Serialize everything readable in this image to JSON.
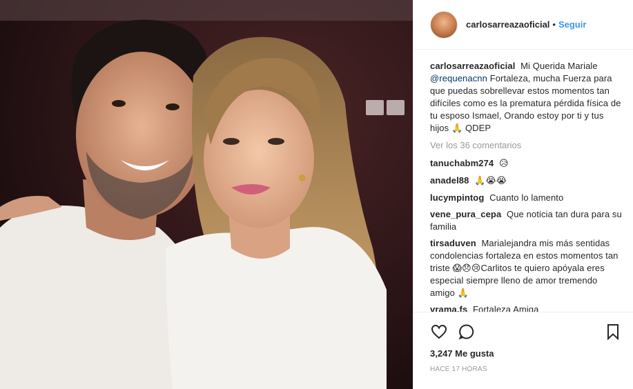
{
  "post": {
    "author": "carlosarreazaoficial",
    "dot": "•",
    "follow_label": "Seguir",
    "caption": {
      "user": "carlosarreazaoficial",
      "text_before_mention": "Mi Querida Mariale",
      "mention": "@requenacnn",
      "text_after_mention": "Fortaleza, mucha Fuerza para que puedas sobrellevar estos momentos tan difíciles como es la prematura pérdida física de tu esposo Ismael, Orando estoy por ti y tus hijos 🙏 QDEP"
    },
    "view_all_comments": "Ver los 36 comentarios",
    "comments": [
      {
        "user": "tanuchabm274",
        "text": "😥"
      },
      {
        "user": "anadel88",
        "text": "🙏😭😭"
      },
      {
        "user": "lucympintog",
        "text": "Cuanto lo lamento"
      },
      {
        "user": "vene_pura_cepa",
        "text": "Que noticia tan dura para su familia"
      },
      {
        "user": "tirsaduven",
        "text": "Marialejandra mis más sentidas condolencias fortaleza en estos momentos tan triste 😱😞😢Carlitos te quiero apóyala eres especial siempre lleno de amor tremendo amigo 🙏"
      },
      {
        "user": "vrama.fs",
        "text": "Fortaleza Amiga"
      }
    ],
    "likes": "3,247 Me gusta",
    "time_ago": "HACE 17 HORAS"
  },
  "icons": {
    "like": "heart-icon",
    "comment": "comment-icon",
    "save": "bookmark-icon"
  },
  "colors": {
    "link": "#3897f0",
    "mention": "#003569",
    "muted": "#999999",
    "text": "#262626",
    "border": "#efefef"
  }
}
